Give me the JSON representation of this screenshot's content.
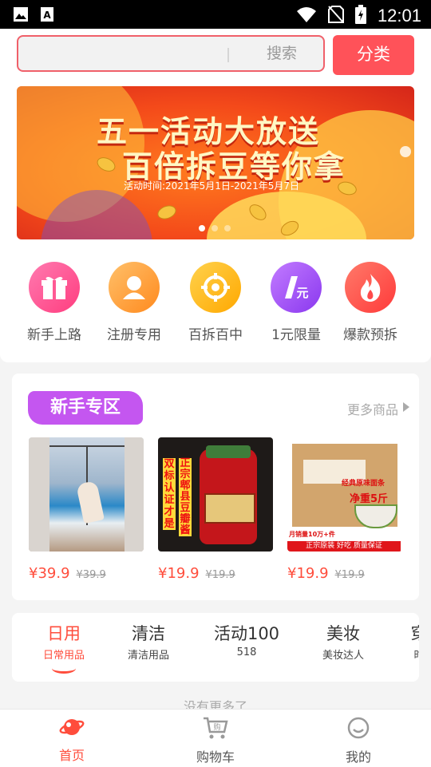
{
  "status_bar": {
    "time": "12:01"
  },
  "search": {
    "placeholder": "",
    "button_label": "搜索"
  },
  "category_button": "分类",
  "banner": {
    "title_line1": "五一活动大放送",
    "title_line2": "百倍拆豆等你拿",
    "date_text": "活动时间:2021年5月1日-2021年5月7日",
    "page_count": 3,
    "active_page": 1
  },
  "quick_nav": [
    {
      "label": "新手上路",
      "icon": "gift-icon",
      "color": "#ff4b8a"
    },
    {
      "label": "注册专用",
      "icon": "user-icon",
      "color": "#ff9a2e"
    },
    {
      "label": "百拆百中",
      "icon": "target-icon",
      "color": "#ffb300"
    },
    {
      "label": "1元限量",
      "icon": "one-yuan-icon",
      "color": "#a24bf0"
    },
    {
      "label": "爆款预拆",
      "icon": "fire-icon",
      "color": "#ff4a4a"
    }
  ],
  "newbie_section": {
    "title": "新手专区",
    "more_label": "更多商品",
    "products": [
      {
        "price": "¥39.9",
        "old_price": "¥39.9",
        "image": "yoga-room-photo"
      },
      {
        "price": "¥19.9",
        "old_price": "¥19.9",
        "image": "bean-paste-jar-photo",
        "image_text": [
          "双标认证才是",
          "正宗郫县豆瓣酱"
        ]
      },
      {
        "price": "¥19.9",
        "old_price": "¥19.9",
        "image": "noodle-box-photo",
        "image_text": [
          "经典原味面条",
          "净重5斤",
          "月销量10万+件",
          "正宗原装 好吃 质量保证"
        ]
      }
    ]
  },
  "category_tabs": [
    {
      "title": "日用",
      "sub": "日常用品",
      "active": true
    },
    {
      "title": "清洁",
      "sub": "清洁用品",
      "active": false
    },
    {
      "title": "活动100",
      "sub": "518",
      "active": false
    },
    {
      "title": "美妆",
      "sub": "美妆达人",
      "active": false
    },
    {
      "title": "穿",
      "sub": "时",
      "active": false
    }
  ],
  "no_more_text": "没有更多了",
  "bottom_nav": [
    {
      "label": "首页",
      "icon": "planet-icon",
      "active": true
    },
    {
      "label": "购物车",
      "icon": "cart-icon",
      "active": false
    },
    {
      "label": "我的",
      "icon": "smile-icon",
      "active": false
    }
  ],
  "colors": {
    "accent": "#ff4d3c",
    "category_button": "#ff5259",
    "section_title_bg": "#c456f0"
  }
}
